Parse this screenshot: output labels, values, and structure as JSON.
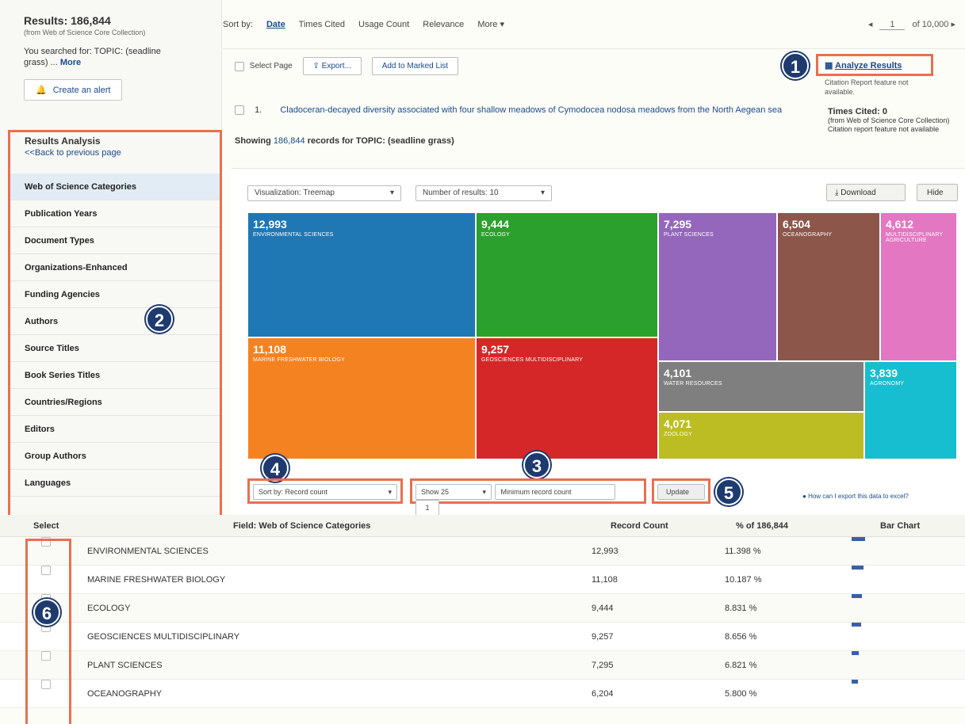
{
  "left": {
    "results_count": "Results: 186,844",
    "results_sub": "(from Web of Science Core Collection)",
    "searched_prefix": "You searched for: TOPIC: (seadline",
    "searched_rest": "grass) ...",
    "searched_more": "More",
    "alert_label": "Create an alert",
    "analysis_title": "Results Analysis",
    "analysis_back": "<<Back to previous page",
    "facets": [
      "Web of Science Categories",
      "Publication Years",
      "Document Types",
      "Organizations-Enhanced",
      "Funding Agencies",
      "Authors",
      "Source Titles",
      "Book Series Titles",
      "Countries/Regions",
      "Editors",
      "Group Authors",
      "Languages"
    ]
  },
  "topbar": {
    "sort_label": "Sort by:",
    "sort_options": [
      "Date",
      "Times Cited",
      "Usage Count",
      "Relevance",
      "More ▾"
    ],
    "pager_prefix": "◂",
    "pager_page": "1",
    "pager_suffix": "of 10,000 ▸"
  },
  "toolbar": {
    "select_page": "Select Page",
    "export": "Export...",
    "add_marked": "Add to Marked List"
  },
  "analyze": {
    "label": "Analyze Results",
    "sub": "Citation Report feature not available."
  },
  "record1": {
    "num": "1.",
    "title": "Cladoceran-decayed diversity associated with four shallow meadows of Cymodocea nodosa meadows from the North Aegean sea"
  },
  "times_cited": {
    "label": "Times Cited: 0",
    "sub": "(from Web of Science Core Collection)",
    "note": "Citation report feature not available"
  },
  "showing": {
    "prefix": "Showing",
    "count": "186,844",
    "suffix": "records for TOPIC: (seadline grass)"
  },
  "viz_controls": {
    "vis_select": "Visualization: Treemap",
    "num_select": "Number of results: 10",
    "download": "Download",
    "hide": "Hide"
  },
  "chart_data": {
    "type": "treemap",
    "items": [
      {
        "value": "12,993",
        "label": "ENVIRONMENTAL SCIENCES",
        "color": "#1f77b4"
      },
      {
        "value": "9,444",
        "label": "ECOLOGY",
        "color": "#2ca02c"
      },
      {
        "value": "7,295",
        "label": "PLANT SCIENCES",
        "color": "#9467bd"
      },
      {
        "value": "6,504",
        "label": "OCEANOGRAPHY",
        "color": "#8c564b"
      },
      {
        "value": "4,612",
        "label": "MULTIDISCIPLINARY AGRICULTURE",
        "color": "#e377c2"
      },
      {
        "value": "11,108",
        "label": "MARINE FRESHWATER BIOLOGY",
        "color": "#f58220"
      },
      {
        "value": "9,257",
        "label": "GEOSCIENCES MULTIDISCIPLINARY",
        "color": "#d62728"
      },
      {
        "value": "4,101",
        "label": "WATER RESOURCES",
        "color": "#7f7f7f"
      },
      {
        "value": "3,839",
        "label": "AGRONOMY",
        "color": "#17becf"
      },
      {
        "value": "4,071",
        "label": "ZOOLOGY",
        "color": "#bcbd22"
      }
    ]
  },
  "bottom_controls": {
    "sort_by": "Sort by: Record count",
    "show": "Show 25",
    "min_count": "Minimum record count",
    "min_val": "1",
    "update": "Update",
    "hint": "How can I export this data to excel?"
  },
  "badges": {
    "b1": "1",
    "b2": "2",
    "b3": "3",
    "b4": "4",
    "b5": "5",
    "b6": "6"
  },
  "table": {
    "headers": [
      "Select",
      "Field: Web of Science Categories",
      "Record Count",
      "% of 186,844",
      "Bar Chart"
    ],
    "rows": [
      {
        "name": "ENVIRONMENTAL SCIENCES",
        "count": "12,993",
        "pct": "11.398 %",
        "bar": 0.24
      },
      {
        "name": "MARINE FRESHWATER BIOLOGY",
        "count": "11,108",
        "pct": "10.187 %",
        "bar": 0.21
      },
      {
        "name": "ECOLOGY",
        "count": "9,444",
        "pct": "8.831 %",
        "bar": 0.18
      },
      {
        "name": "GEOSCIENCES MULTIDISCIPLINARY",
        "count": "9,257",
        "pct": "8.656 %",
        "bar": 0.17
      },
      {
        "name": "PLANT SCIENCES",
        "count": "7,295",
        "pct": "6.821 %",
        "bar": 0.13
      },
      {
        "name": "OCEANOGRAPHY",
        "count": "6,204",
        "pct": "5.800 %",
        "bar": 0.11
      }
    ]
  }
}
